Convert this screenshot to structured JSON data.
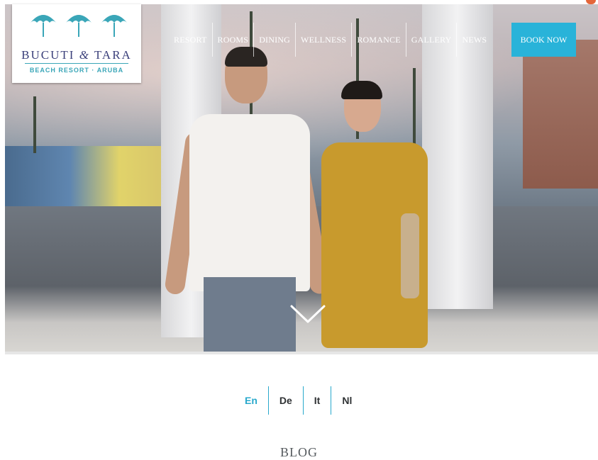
{
  "brand": {
    "name_left": "BUCUTI",
    "name_amp": "&",
    "name_right": "TARA",
    "subtitle": "BEACH RESORT · ARUBA",
    "accent_color": "#29b3d9",
    "brand_navy": "#3a3f7a"
  },
  "nav": {
    "items": [
      {
        "label": "Resort"
      },
      {
        "label": "Rooms"
      },
      {
        "label": "Dining"
      },
      {
        "label": "Wellness"
      },
      {
        "label": "Romance"
      },
      {
        "label": "Gallery"
      },
      {
        "label": "News"
      }
    ],
    "book_now": "Book Now"
  },
  "hero": {
    "scroll_icon": "chevron-down-icon"
  },
  "languages": {
    "items": [
      "En",
      "De",
      "It",
      "Nl"
    ],
    "active": "En"
  },
  "section": {
    "title": "Blog"
  }
}
